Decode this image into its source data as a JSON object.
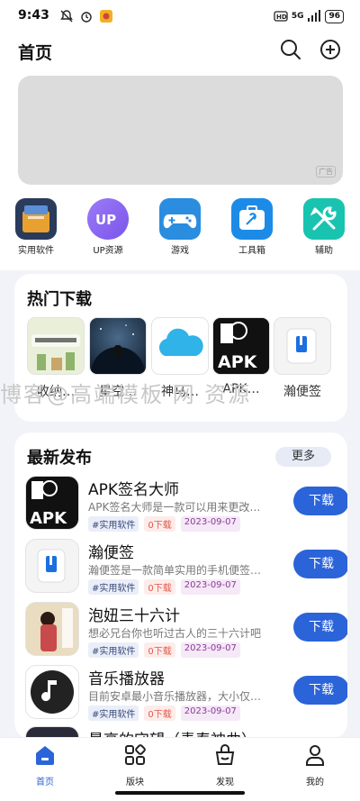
{
  "status_bar": {
    "time": "9:43",
    "battery": "96",
    "network": "5G"
  },
  "header": {
    "title": "首页"
  },
  "banner": {
    "ad_label": "广告"
  },
  "quick_links": [
    {
      "label": "实用软件",
      "icon": "toolbox-app-icon",
      "color": "#3a6fc0"
    },
    {
      "label": "UP资源",
      "icon": "up-badge-icon",
      "color": "#8a6df0"
    },
    {
      "label": "游戏",
      "icon": "gamepad-icon",
      "color": "#2a8de0"
    },
    {
      "label": "工具箱",
      "icon": "toolbox-icon",
      "color": "#1c8be8"
    },
    {
      "label": "辅助",
      "icon": "wrench-icon",
      "color": "#18c4b0"
    }
  ],
  "hot_downloads": {
    "title": "热门下载",
    "items": [
      {
        "name": "收纳…"
      },
      {
        "name": "星空…"
      },
      {
        "name": "神马…"
      },
      {
        "name": "APK…"
      },
      {
        "name": "瀚便签"
      }
    ]
  },
  "watermark": "博客@高端模板 网 资源",
  "latest": {
    "title": "最新发布",
    "more_label": "更多",
    "download_label": "下载",
    "apps": [
      {
        "name": "APK签名大师",
        "desc": "APK签名大师是一款可以用来更改应用签名的工具",
        "category": "#实用软件",
        "downloads": "0下载",
        "date": "2023-09-07"
      },
      {
        "name": "瀚便签",
        "desc": "瀚便签是一款简单实用的手机便签记事软件",
        "category": "#实用软件",
        "downloads": "0下载",
        "date": "2023-09-07"
      },
      {
        "name": "泡妞三十六计",
        "desc": "想必兄台你也听过古人的三十六计吧",
        "category": "#实用软件",
        "downloads": "0下载",
        "date": "2023-09-07"
      },
      {
        "name": "音乐播放器",
        "desc": "目前安卓最小音乐播放器，大小仅有几十KB",
        "category": "#实用软件",
        "downloads": "0下载",
        "date": "2023-09-07"
      },
      {
        "name": "最高的守望（青春神曲）"
      }
    ]
  },
  "bottom_nav": [
    {
      "label": "首页",
      "active": true
    },
    {
      "label": "版块"
    },
    {
      "label": "发现"
    },
    {
      "label": "我的"
    }
  ],
  "colors": {
    "accent": "#2b63d9",
    "background": "#f2f3f8"
  }
}
